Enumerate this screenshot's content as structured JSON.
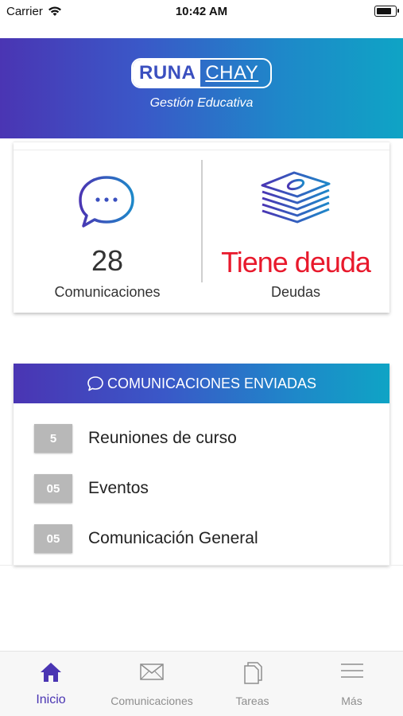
{
  "status_bar": {
    "carrier": "Carrier",
    "time": "10:42 AM"
  },
  "header": {
    "logo_left": "RUNA",
    "logo_right": "CHAY",
    "subtitle": "Gestión Educativa",
    "gradient_colors": [
      "#4a35b3",
      "#0fa4c5"
    ]
  },
  "stats": {
    "communications": {
      "count": "28",
      "label": "Comunicaciones",
      "icon": "chat-bubble-icon"
    },
    "debts": {
      "status": "Tiene deuda",
      "label": "Deudas",
      "icon": "money-stack-icon",
      "status_color": "#e8192c"
    }
  },
  "sent_communications": {
    "title": "COMUNICACIONES ENVIADAS",
    "items": [
      {
        "count": "5",
        "label": "Reuniones de curso"
      },
      {
        "count": "05",
        "label": "Eventos"
      },
      {
        "count": "05",
        "label": "Comunicación General"
      }
    ]
  },
  "tab_bar": {
    "active_color": "#4a35b3",
    "tabs": [
      {
        "label": "Inicio",
        "icon": "home-icon",
        "active": true
      },
      {
        "label": "Comunicaciones",
        "icon": "envelope-icon",
        "active": false
      },
      {
        "label": "Tareas",
        "icon": "document-icon",
        "active": false
      },
      {
        "label": "Más",
        "icon": "menu-icon",
        "active": false
      }
    ]
  }
}
